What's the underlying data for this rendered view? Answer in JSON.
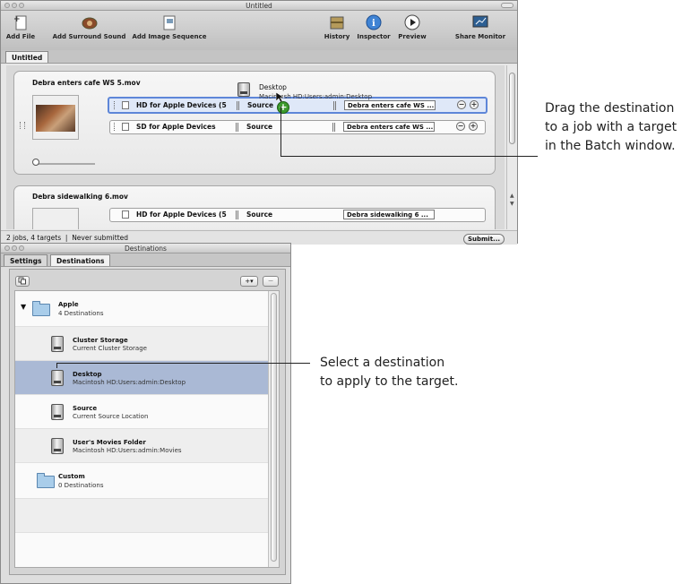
{
  "batch_window": {
    "title": "Untitled",
    "toolbar": {
      "add_file": "Add File",
      "add_surround_sound": "Add Surround Sound",
      "add_image_sequence": "Add Image Sequence",
      "history": "History",
      "inspector": "Inspector",
      "preview": "Preview",
      "share_monitor": "Share Monitor"
    },
    "tab": "Untitled",
    "jobs": [
      {
        "title": "Debra enters cafe WS 5.mov",
        "targets": [
          {
            "setting": "HD for Apple Devices (5",
            "destination_label": "Source",
            "output": "Debra enters cafe WS ..."
          },
          {
            "setting": "SD for Apple Devices",
            "destination_label": "Source",
            "output": "Debra enters cafe WS ..."
          }
        ]
      },
      {
        "title": "Debra sidewalking 6.mov",
        "targets": [
          {
            "setting": "HD for Apple Devices (5",
            "destination_label": "Source",
            "output": "Debra sidewalking 6 ..."
          }
        ]
      }
    ],
    "drag_tooltip": {
      "name": "Desktop",
      "path": "Macintosh HD:Users:admin:Desktop"
    },
    "status": "2 jobs, 4 targets  |  Never submitted",
    "submit": "Submit..."
  },
  "destinations_window": {
    "title": "Destinations",
    "tabs": [
      "Settings",
      "Destinations"
    ],
    "add_button": "+▾",
    "remove_button": "−",
    "groups": [
      {
        "name": "Apple",
        "count": "4 Destinations"
      },
      {
        "name": "Custom",
        "count": "0 Destinations"
      }
    ],
    "items": [
      {
        "name": "Cluster Storage",
        "sub": "Current Cluster Storage"
      },
      {
        "name": "Desktop",
        "sub": "Macintosh HD:Users:admin:Desktop"
      },
      {
        "name": "Source",
        "sub": "Current Source Location"
      },
      {
        "name": "User's Movies Folder",
        "sub": "Macintosh HD:Users:admin:Movies"
      }
    ]
  },
  "callouts": {
    "drag": [
      "Drag the destination",
      "to a job with a target",
      "in the Batch window."
    ],
    "select": [
      "Select a destination",
      "to apply to the target."
    ]
  },
  "colors": {
    "selection_blue": "#5e86d8",
    "selected_row": "#aab9d5",
    "add_badge": "#3c9a2c"
  }
}
